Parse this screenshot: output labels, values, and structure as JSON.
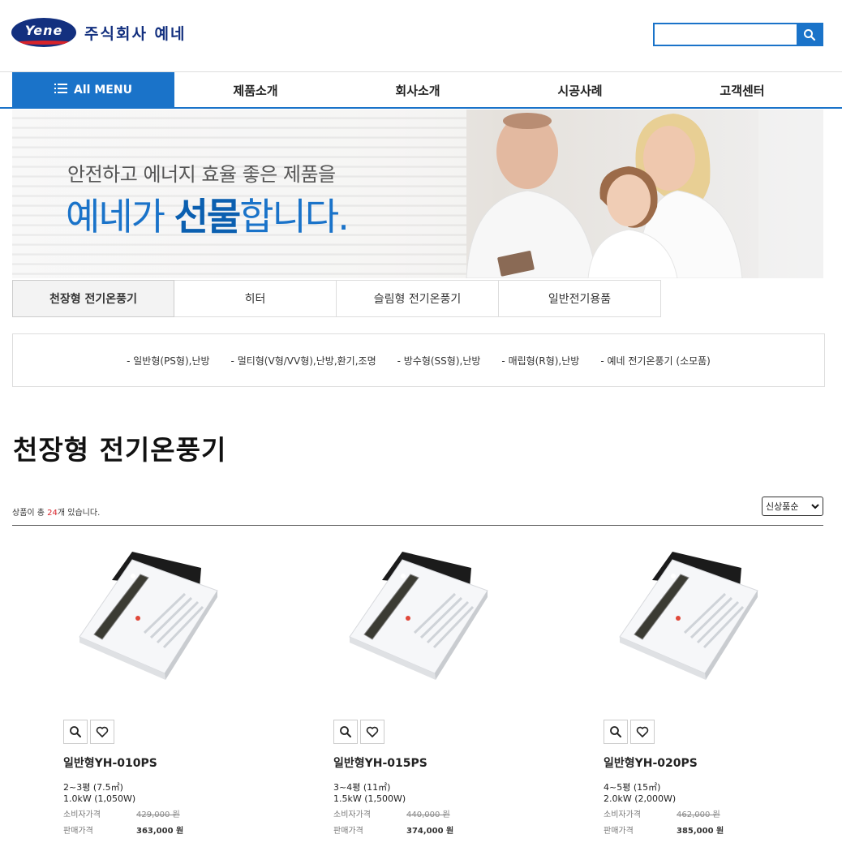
{
  "header": {
    "logo_text": "Yene",
    "company_name": "주식회사 예네",
    "search_placeholder": "",
    "colors": {
      "brand": "#13307f",
      "accent": "#1a73c9",
      "logo_red": "#d8232a"
    }
  },
  "nav": {
    "all_menu": "All MENU",
    "items": [
      "제품소개",
      "회사소개",
      "시공사례",
      "고객센터"
    ]
  },
  "banner": {
    "subtitle": "안전하고 에너지 효율 좋은 제품을",
    "main_prefix": "예네가 ",
    "main_bold": "선물",
    "main_suffix": "합니다."
  },
  "category_tabs": [
    "천장형 전기온풍기",
    "히터",
    "슬림형 전기온풍기",
    "일반전기용품"
  ],
  "subcategories": [
    "- 일반형(PS형),난방",
    "- 멀티형(V형/VV형),난방,환기,조명",
    "- 방수형(SS형),난방",
    "- 매립형(R형),난방",
    "- 예네 전기온풍기 (소모품)"
  ],
  "page_title": "천장형 전기온풍기",
  "listing": {
    "count_prefix": "상품이 총 ",
    "count": "24",
    "count_suffix": "개 있습니다.",
    "sort_selected": "신상품순"
  },
  "products": [
    {
      "name": "일반형YH-010PS",
      "spec1": "2~3평 (7.5㎡)",
      "spec2": "1.0kW (1,050W)",
      "consumer_label": "소비자가격",
      "consumer_price": "429,000 원",
      "sale_label": "판매가격",
      "sale_price": "363,000 원"
    },
    {
      "name": "일반형YH-015PS",
      "spec1": "3~4평 (11㎡)",
      "spec2": "1.5kW (1,500W)",
      "consumer_label": "소비자가격",
      "consumer_price": "440,000 원",
      "sale_label": "판매가격",
      "sale_price": "374,000 원"
    },
    {
      "name": "일반형YH-020PS",
      "spec1": "4~5평 (15㎡)",
      "spec2": "2.0kW (2,000W)",
      "consumer_label": "소비자가격",
      "consumer_price": "462,000 원",
      "sale_label": "판매가격",
      "sale_price": "385,000 원"
    }
  ],
  "icons": {
    "search": "search-icon",
    "menu": "menu-icon",
    "zoom": "zoom-icon",
    "wishlist": "heart-icon"
  }
}
